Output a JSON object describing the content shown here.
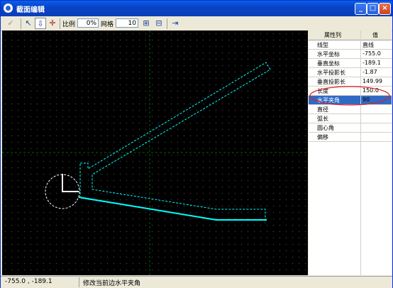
{
  "window": {
    "title": "截面编辑"
  },
  "toolbar": {
    "scale_label": "比例",
    "scale_value": "0%",
    "grid_label": "网格",
    "grid_value": "10"
  },
  "properties": {
    "header": [
      "属性列",
      "值"
    ],
    "rows": [
      {
        "key": "线型",
        "value": "直线"
      },
      {
        "key": "水平坐标",
        "value": "-755.0"
      },
      {
        "key": "垂直坐标",
        "value": "-189.1"
      },
      {
        "key": "水平投影长",
        "value": "-1.87"
      },
      {
        "key": "垂直投影长",
        "value": "149.99"
      },
      {
        "key": "长度",
        "value": "150.0"
      },
      {
        "key": "水平夹角",
        "value": "90"
      },
      {
        "key": "直径",
        "value": ""
      },
      {
        "key": "弧长",
        "value": ""
      },
      {
        "key": "圆心角",
        "value": ""
      },
      {
        "key": "偏移",
        "value": ""
      }
    ]
  },
  "status": {
    "coords": "-755.0 ,  -189.1",
    "message": "修改当前边水平夹角"
  },
  "colors": {
    "shape": "#00ffff",
    "guide": "#006400",
    "highlight_ellipse": "#e02020",
    "selection": "#316ac5"
  }
}
